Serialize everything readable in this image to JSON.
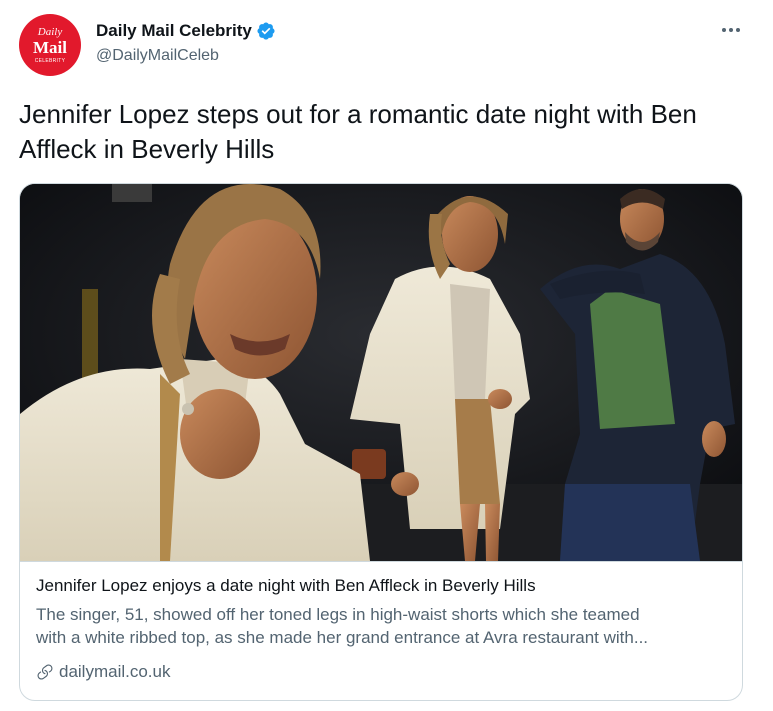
{
  "account": {
    "avatar_line1": "Daily",
    "avatar_line2": "Mail",
    "avatar_line3": "CELEBRITY",
    "display_name": "Daily Mail Celebrity",
    "handle": "@DailyMailCeleb",
    "verified_icon": "verified-badge-icon",
    "brand_color": "#e2192c",
    "verified_color": "#1d9bf0"
  },
  "menu": {
    "icon": "more-icon"
  },
  "tweet": {
    "text": "Jennifer Lopez steps out for a romantic date night with Ben Affleck in Beverly Hills"
  },
  "card": {
    "image_icon": "photo",
    "title": "Jennifer Lopez enjoys a date night with Ben Affleck in Beverly Hills",
    "description_line1": "The singer, 51, showed off her toned legs in high-waist shorts which she teamed",
    "description_line2": "with a white ribbed top, as she made her grand entrance at Avra restaurant with...",
    "domain": "dailymail.co.uk",
    "link_icon": "link-icon"
  },
  "colors": {
    "text_primary": "#0f1419",
    "text_secondary": "#536471",
    "border": "#cfd9de"
  }
}
